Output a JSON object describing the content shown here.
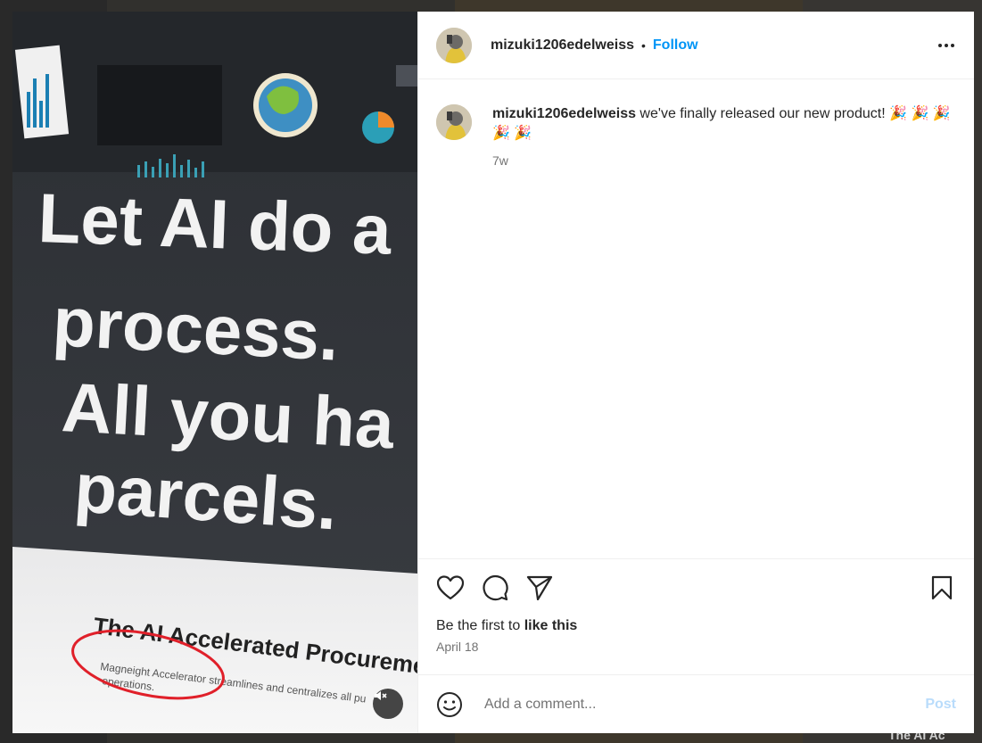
{
  "post": {
    "author": "mizuki1206edelweiss",
    "follow_label": "Follow",
    "separator": "•",
    "caption_text": " we've finally released our new product! 🎉 🎉 🎉 🎉 🎉",
    "caption_age": "7w",
    "likes_prefix": "Be the first to ",
    "likes_action": "like this",
    "date": "April 18"
  },
  "comment": {
    "placeholder": "Add a comment...",
    "post_label": "Post"
  },
  "media": {
    "headline_lines": [
      "Let AI do a",
      "process.",
      "All you ha",
      "parcels."
    ],
    "card_title": "The AI Accelerated Procureme",
    "card_subtitle_1": "Magneight Accelerator streamlines and centralizes all pu",
    "card_subtitle_2": "operations."
  },
  "background": {
    "corner_text": "The AI Ac"
  },
  "icons": {
    "like": "heart-icon",
    "comment": "comment-bubble-icon",
    "share": "paper-plane-icon",
    "save": "bookmark-icon",
    "more": "more-options-icon",
    "mute": "speaker-muted-icon",
    "emoji": "emoji-smile-icon"
  },
  "colors": {
    "link_blue": "#0095f6",
    "post_disabled": "#b9dcfb",
    "annotation_red": "#e0202a"
  }
}
